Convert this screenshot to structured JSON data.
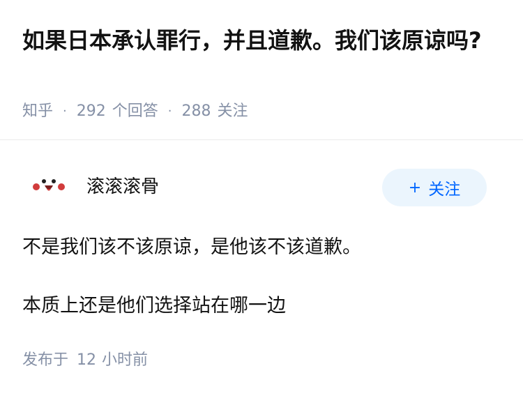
{
  "question": {
    "title": "如果日本承认罪行，并且道歉。我们该原谅吗?",
    "source": "知乎",
    "answer_count": "292",
    "answer_count_label": "个回答",
    "follow_count": "288",
    "follow_count_label": "关注"
  },
  "answer": {
    "author_name": "滚滚滚骨",
    "follow_button": {
      "icon": "+",
      "label": "关注"
    },
    "paragraphs": [
      "不是我们该不该原谅，是他该不该道歉。",
      "本质上还是他们选择站在哪一边"
    ],
    "published_label": "发布于",
    "published_num": "12",
    "published_unit": "小时前"
  },
  "colors": {
    "accent": "#0066ff",
    "follow_bg": "#ebf5fd",
    "meta_gray": "#8590a6",
    "text": "#121212",
    "avatar_red": "#d13c3c"
  }
}
